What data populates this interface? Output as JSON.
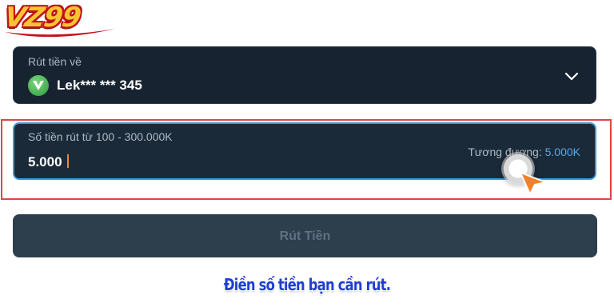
{
  "brand": {
    "logo_text": "VZ99",
    "logo_color": "#f7c531",
    "logo_outline_color": "#c2121b"
  },
  "withdraw_to": {
    "label": "Rút tiền về",
    "account": "Lek*** *** 345",
    "bank_icon": "bank-logo-icon",
    "dropdown_icon": "chevron-down-icon"
  },
  "amount": {
    "label": "Số tiền rút từ 100 - 300.000K",
    "value": "5.000",
    "equivalent_label": "Tương đương:",
    "equivalent_value": "5.000K",
    "border_color": "#3b9ad9",
    "accent_color": "#58a9e3"
  },
  "withdraw_button": {
    "label": "Rút Tiền",
    "enabled": false
  },
  "caption": {
    "text": "Điền số tiền bạn cần rút.",
    "color": "#1f3fd1"
  },
  "highlight_color": "#e04545"
}
